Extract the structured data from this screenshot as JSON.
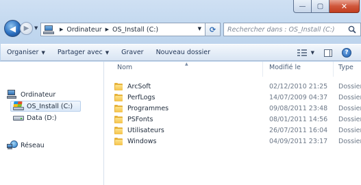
{
  "window": {
    "minimize_label": "—",
    "maximize_label": "▢",
    "close_label": "✕"
  },
  "address_bar": {
    "segments": [
      "Ordinateur",
      "OS_Install (C:)"
    ],
    "refresh_symbol": "⟳"
  },
  "search": {
    "placeholder": "Rechercher dans : OS_Install (C:)"
  },
  "command_bar": {
    "organise": "Organiser",
    "share": "Partager avec",
    "burn": "Graver",
    "new_folder": "Nouveau dossier",
    "help": "?"
  },
  "nav_pane": {
    "computer": "Ordinateur",
    "os_drive": "OS_Install (C:)",
    "data_drive": "Data (D:)",
    "network": "Réseau"
  },
  "columns": {
    "name": "Nom",
    "modified": "Modifié le",
    "type": "Type"
  },
  "files": [
    {
      "name": "ArcSoft",
      "modified": "02/12/2010 21:25",
      "type": "Dossier"
    },
    {
      "name": "PerfLogs",
      "modified": "14/07/2009 04:37",
      "type": "Dossier"
    },
    {
      "name": "Programmes",
      "modified": "09/08/2011 23:48",
      "type": "Dossier"
    },
    {
      "name": "PSFonts",
      "modified": "08/01/2011 14:56",
      "type": "Dossier"
    },
    {
      "name": "Utilisateurs",
      "modified": "26/07/2011 16:04",
      "type": "Dossier"
    },
    {
      "name": "Windows",
      "modified": "04/09/2011 23:17",
      "type": "Dossier"
    }
  ]
}
